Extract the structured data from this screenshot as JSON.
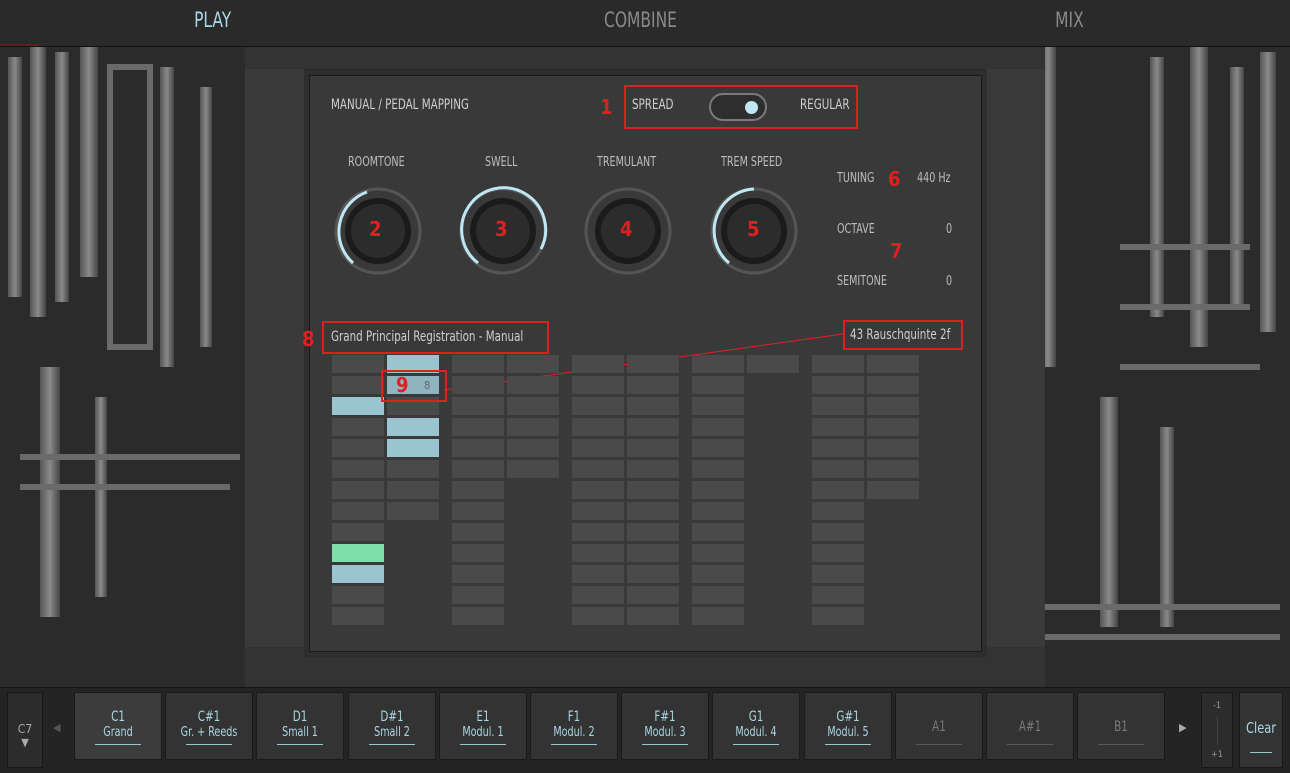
{
  "tabs": {
    "play": "PLAY",
    "combine": "COMBINE",
    "mix": "MIX"
  },
  "mapping": {
    "title": "MANUAL / PEDAL MAPPING",
    "left": "SPREAD",
    "right": "REGULAR"
  },
  "knobs": [
    {
      "label": "ROOMTONE",
      "num": "2"
    },
    {
      "label": "SWELL",
      "num": "3"
    },
    {
      "label": "TREMULANT",
      "num": "4"
    },
    {
      "label": "TREM SPEED",
      "num": "5"
    }
  ],
  "tuning": {
    "tuning_label": "TUNING",
    "tuning_value": "440 Hz",
    "octave_label": "OCTAVE",
    "octave_value": "0",
    "semitone_label": "SEMITONE",
    "semitone_value": "0"
  },
  "annotations": {
    "n1": "1",
    "n6": "6",
    "n7": "7",
    "n8": "8",
    "n9": "9"
  },
  "registration": {
    "title": "Grand Principal Registration - Manual",
    "stop_name": "43 Rauschquinte 2f",
    "hover_stop_number": "8"
  },
  "bottom": {
    "octave": "C7",
    "presets": [
      {
        "note": "C1",
        "label": "Grand"
      },
      {
        "note": "C#1",
        "label": "Gr. + Reeds"
      },
      {
        "note": "D1",
        "label": "Small 1"
      },
      {
        "note": "D#1",
        "label": "Small 2"
      },
      {
        "note": "E1",
        "label": "Modul. 1"
      },
      {
        "note": "F1",
        "label": "Modul. 2"
      },
      {
        "note": "F#1",
        "label": "Modul. 3"
      },
      {
        "note": "G1",
        "label": "Modul. 4"
      },
      {
        "note": "G#1",
        "label": "Modul. 5"
      },
      {
        "note": "A1",
        "label": ""
      },
      {
        "note": "A#1",
        "label": ""
      },
      {
        "note": "B1",
        "label": ""
      }
    ],
    "minus": "-1",
    "plus": "+1",
    "clear": "Clear"
  },
  "colors": {
    "accent": "#a9d6e5",
    "annotation": "#e02020",
    "stop_on": "#9bc4d1",
    "stop_green": "#7edfa8"
  }
}
